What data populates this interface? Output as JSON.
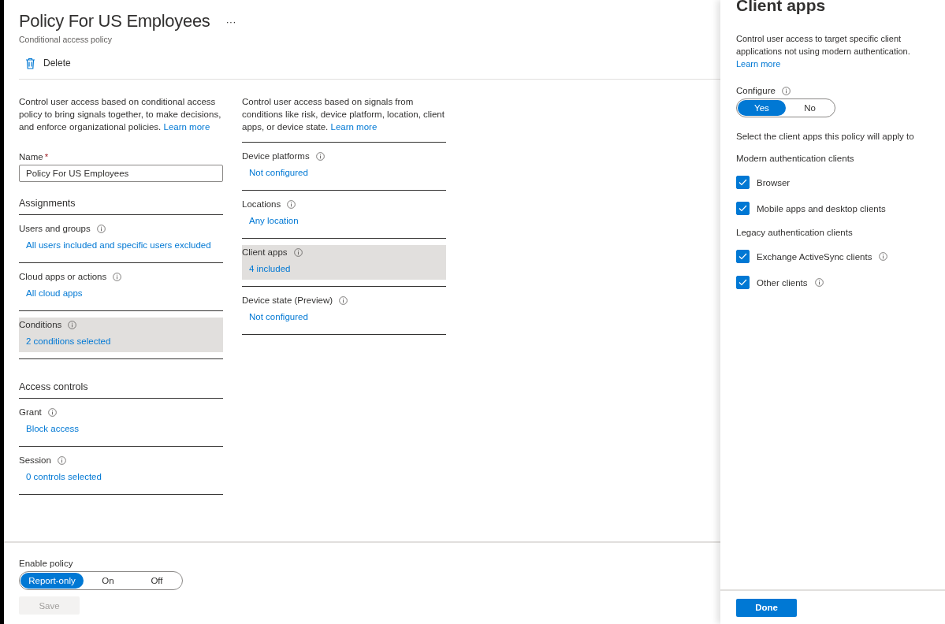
{
  "header": {
    "title": "Policy For US Employees",
    "more": "···",
    "subtitle": "Conditional access policy"
  },
  "toolbar": {
    "delete": "Delete"
  },
  "intro": {
    "text": "Control user access based on conditional access policy to bring signals together, to make decisions, and enforce organizational policies.",
    "link": "Learn more"
  },
  "name_field": {
    "label": "Name",
    "required": "*",
    "value": "Policy For US Employees"
  },
  "assignments": {
    "heading": "Assignments",
    "rows": [
      {
        "label": "Users and groups",
        "value": "All users included and specific users excluded",
        "selected": false
      },
      {
        "label": "Cloud apps or actions",
        "value": "All cloud apps",
        "selected": false
      },
      {
        "label": "Conditions",
        "value": "2 conditions selected",
        "selected": true
      }
    ]
  },
  "access_controls": {
    "heading": "Access controls",
    "rows": [
      {
        "label": "Grant",
        "value": "Block access",
        "selected": false
      },
      {
        "label": "Session",
        "value": "0 controls selected",
        "selected": false
      }
    ]
  },
  "conditions": {
    "intro": "Control user access based on signals from conditions like risk, device platform, location, client apps, or device state.",
    "link": "Learn more",
    "rows": [
      {
        "label": "Device platforms",
        "value": "Not configured",
        "selected": false
      },
      {
        "label": "Locations",
        "value": "Any location",
        "selected": false
      },
      {
        "label": "Client apps",
        "value": "4 included",
        "selected": true
      },
      {
        "label": "Device state (Preview)",
        "value": "Not configured",
        "selected": false
      }
    ]
  },
  "enable_policy": {
    "label": "Enable policy",
    "options": [
      {
        "label": "Report-only",
        "selected": true
      },
      {
        "label": "On",
        "selected": false
      },
      {
        "label": "Off",
        "selected": false
      }
    ]
  },
  "save": {
    "label": "Save",
    "disabled": true
  },
  "panel": {
    "title": "Client apps",
    "description": "Control user access to target specific client applications not using modern authentication.",
    "link": "Learn more",
    "configure": {
      "label": "Configure",
      "options": [
        {
          "label": "Yes",
          "selected": true
        },
        {
          "label": "No",
          "selected": false
        }
      ]
    },
    "prompt": "Select the client apps this policy will apply to",
    "groups": [
      {
        "heading": "Modern authentication clients",
        "items": [
          {
            "label": "Browser",
            "checked": true,
            "info": false
          },
          {
            "label": "Mobile apps and desktop clients",
            "checked": true,
            "info": false
          }
        ]
      },
      {
        "heading": "Legacy authentication clients",
        "items": [
          {
            "label": "Exchange ActiveSync clients",
            "checked": true,
            "info": true
          },
          {
            "label": "Other clients",
            "checked": true,
            "info": true
          }
        ]
      }
    ],
    "done": "Done"
  }
}
